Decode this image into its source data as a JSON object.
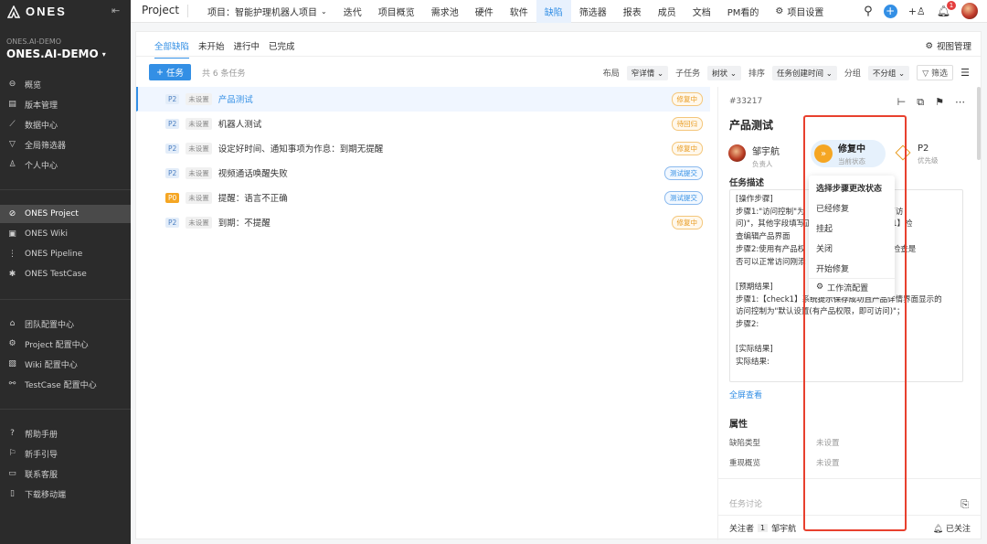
{
  "sidebar": {
    "brand": "ONES",
    "org_label": "ONES.AI-DEMO",
    "org_name": "ONES.AI-DEMO",
    "items_top": [
      {
        "label": "概览",
        "icon": "overview-icon"
      },
      {
        "label": "版本管理",
        "icon": "version-icon"
      },
      {
        "label": "数据中心",
        "icon": "chart-icon"
      },
      {
        "label": "全局筛选器",
        "icon": "filter-icon"
      },
      {
        "label": "个人中心",
        "icon": "user-icon"
      }
    ],
    "items_products": [
      {
        "label": "ONES Project",
        "icon": "project-icon"
      },
      {
        "label": "ONES Wiki",
        "icon": "wiki-icon"
      },
      {
        "label": "ONES Pipeline",
        "icon": "pipeline-icon"
      },
      {
        "label": "ONES TestCase",
        "icon": "testcase-icon"
      }
    ],
    "items_config": [
      {
        "label": "团队配置中心",
        "icon": "team-config-icon"
      },
      {
        "label": "Project 配置中心",
        "icon": "gear-icon"
      },
      {
        "label": "Wiki 配置中心",
        "icon": "wiki-config-icon"
      },
      {
        "label": "TestCase 配置中心",
        "icon": "testcase-config-icon"
      }
    ],
    "items_help": [
      {
        "label": "帮助手册",
        "icon": "help-icon"
      },
      {
        "label": "新手引导",
        "icon": "guide-icon"
      },
      {
        "label": "联系客服",
        "icon": "support-icon"
      },
      {
        "label": "下载移动端",
        "icon": "mobile-icon"
      }
    ]
  },
  "topbar": {
    "module": "Project",
    "project_select": "项目：智能护理机器人项目",
    "nav": [
      "迭代",
      "项目概览",
      "需求池",
      "硬件",
      "软件",
      "缺陷",
      "筛选器",
      "报表",
      "成员",
      "文档",
      "PM看的",
      "项目设置"
    ],
    "current_nav": "缺陷",
    "notification_count": "1"
  },
  "main": {
    "tabs": [
      "全部缺陷",
      "未开始",
      "进行中",
      "已完成"
    ],
    "view_manage": "视图管理",
    "new_task": "任务",
    "count_text": "共 6 条任务",
    "toolbar": {
      "layout_label": "布局",
      "layout_value": "窄详情",
      "subtask_label": "子任务",
      "subtask_value": "树状",
      "sort_label": "排序",
      "sort_value": "任务创建时间",
      "group_label": "分组",
      "group_value": "不分组",
      "filter": "筛选"
    },
    "rows": [
      {
        "priority": "P2",
        "unset": "未设置",
        "title": "产品测试",
        "status": "修复中"
      },
      {
        "priority": "P2",
        "unset": "未设置",
        "title": "机器人测试",
        "status": "待回归"
      },
      {
        "priority": "P2",
        "unset": "未设置",
        "title": "设定好时间、通知事项为作息：到期无提醒",
        "status": "修复中"
      },
      {
        "priority": "P2",
        "unset": "未设置",
        "title": "视频通话唤醒失败",
        "status": "测试提交"
      },
      {
        "priority": "P0",
        "unset": "未设置",
        "title": "提醒：语言不正确",
        "status": "测试提交"
      },
      {
        "priority": "P2",
        "unset": "未设置",
        "title": "到期：不提醒",
        "status": "修复中"
      }
    ]
  },
  "detail": {
    "id": "#33217",
    "title": "产品测试",
    "assignee": "邹宇航",
    "assignee_label": "负责人",
    "status": "修复中",
    "status_label": "当前状态",
    "priority": "P2",
    "priority_label": "优先级",
    "desc_label": "任务描述",
    "description": "[操作步骤]\n步骤1:\"访问控制\"为                     权限，即可访\n问)\"，其他字段填写正                    【check1】检\n查编辑产品界面\n步骤2:使用有产品权                     check2】检查是\n否可以正常访问刚添\n\n[预期结果]\n步骤1:【check1】系统提示保存成功且产品详情界面显示的\n访问控制为\"默认设置(有产品权限，即可访问)\"；\n步骤2:\n\n[实际结果]\n实际结果:",
    "fullscreen": "全屏查看",
    "attr_label": "属性",
    "attrs": [
      {
        "name": "缺陷类型",
        "value": "未设置"
      },
      {
        "name": "重现概览",
        "value": "未设置"
      }
    ],
    "comment_placeholder": "任务讨论",
    "watchers_label": "关注者",
    "watchers_count": "1",
    "watcher": "邹宇航",
    "follow": "已关注"
  },
  "dropdown": {
    "header": "选择步骤更改状态",
    "items": [
      "已经修复",
      "挂起",
      "关闭",
      "开始修复"
    ],
    "workflow": "工作流配置"
  },
  "colors": {
    "accent": "#338fe5",
    "highlight_box": "#e8402e",
    "status_orange": "#f5a623"
  }
}
